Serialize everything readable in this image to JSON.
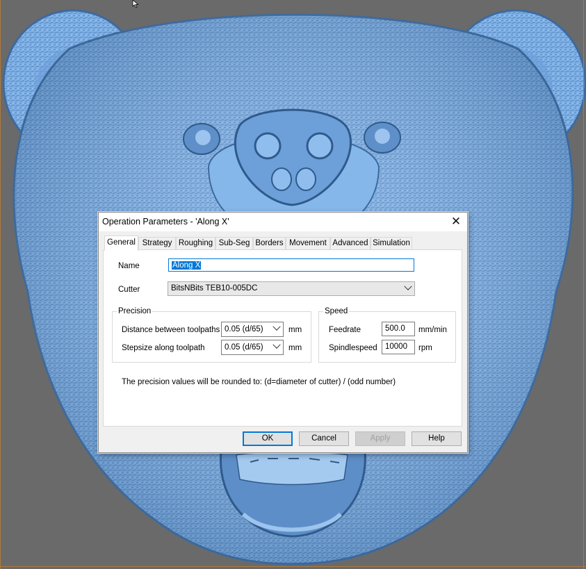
{
  "colors": {
    "viewport_bg": "#6a6a6a",
    "model_blue": "#7fb0e6",
    "model_shadow": "#3d6a9e",
    "frame": "#b07a3c",
    "accent": "#0078d7"
  },
  "dialog": {
    "title": "Operation Parameters - 'Along X'",
    "close_icon": "close-icon",
    "tabs": [
      "General",
      "Strategy",
      "Roughing",
      "Sub-Seg",
      "Borders",
      "Movement",
      "Advanced",
      "Simulation"
    ],
    "active_tab": "General",
    "name_label": "Name",
    "name_value": "Along X",
    "cutter_label": "Cutter",
    "cutter_value": "BitsNBits TEB10-005DC",
    "precision": {
      "title": "Precision",
      "distance_label": "Distance between toolpaths",
      "distance_value": "0.05  (d/65)",
      "distance_unit": "mm",
      "stepsize_label": "Stepsize along toolpath",
      "stepsize_value": "0.05  (d/65)",
      "stepsize_unit": "mm"
    },
    "speed": {
      "title": "Speed",
      "feedrate_label": "Feedrate",
      "feedrate_value": "500.0",
      "feedrate_unit": "mm/min",
      "spindle_label": "Spindlespeed",
      "spindle_value": "10000",
      "spindle_unit": "rpm"
    },
    "note": "The precision values will be rounded to:  (d=diameter of cutter) / (odd number)",
    "buttons": {
      "ok": "OK",
      "cancel": "Cancel",
      "apply": "Apply",
      "help": "Help"
    }
  }
}
